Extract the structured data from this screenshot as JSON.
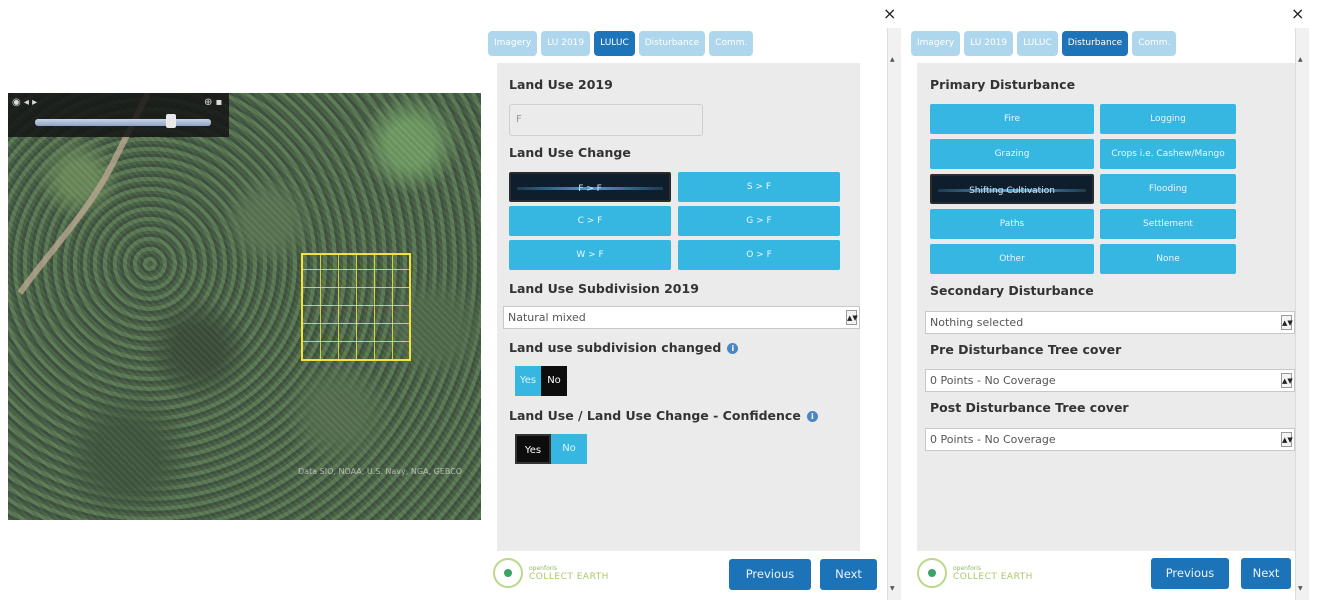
{
  "map": {
    "attribution": "Data SIO, NOAA, U.S. Navy, NGA, GEBCO"
  },
  "left_panel": {
    "tabs": [
      {
        "label": "Imagery",
        "active": false
      },
      {
        "label": "LU 2019",
        "active": false
      },
      {
        "label": "LULUC",
        "active": true
      },
      {
        "label": "Disturbance",
        "active": false
      },
      {
        "label": "Comm.",
        "active": false
      }
    ],
    "land_use_2019": {
      "label": "Land Use 2019",
      "value": "F"
    },
    "land_use_change": {
      "label": "Land Use Change",
      "options": [
        "F > F",
        "S > F",
        "C > F",
        "G > F",
        "W > F",
        "O > F"
      ],
      "selected": "F > F"
    },
    "subdivision": {
      "label": "Land Use Subdivision 2019",
      "value": "Natural mixed"
    },
    "subdivision_changed": {
      "label": "Land use subdivision changed",
      "yes": "Yes",
      "no": "No",
      "selected": "No"
    },
    "confidence": {
      "label": "Land Use / Land Use Change - Confidence",
      "yes": "Yes",
      "no": "No",
      "selected": "Yes"
    },
    "logo": {
      "line1": "openforis",
      "line2": "COLLECT EARTH"
    },
    "previous": "Previous",
    "next": "Next",
    "close": "×"
  },
  "right_panel": {
    "tabs": [
      {
        "label": "Imagery",
        "active": false
      },
      {
        "label": "LU 2019",
        "active": false
      },
      {
        "label": "LULUC",
        "active": false
      },
      {
        "label": "Disturbance",
        "active": true
      },
      {
        "label": "Comm.",
        "active": false
      }
    ],
    "primary": {
      "label": "Primary Disturbance",
      "options": [
        "Fire",
        "Logging",
        "Grazing",
        "Crops i.e. Cashew/Mango",
        "Shifting Cultivation",
        "Flooding",
        "Paths",
        "Settlement",
        "Other",
        "None"
      ],
      "selected": "Shifting Cultivation"
    },
    "secondary": {
      "label": "Secondary Disturbance",
      "value": "Nothing selected"
    },
    "pre_cover": {
      "label": "Pre Disturbance Tree cover",
      "value": "0 Points - No Coverage"
    },
    "post_cover": {
      "label": "Post Disturbance Tree cover",
      "value": "0 Points - No Coverage"
    },
    "logo": {
      "line1": "openforis",
      "line2": "COLLECT EARTH"
    },
    "previous": "Previous",
    "next": "Next",
    "close": "×"
  },
  "colors": {
    "accent": "#35b7e2",
    "nav": "#1d73b8",
    "selected": "#0f1e2c"
  }
}
